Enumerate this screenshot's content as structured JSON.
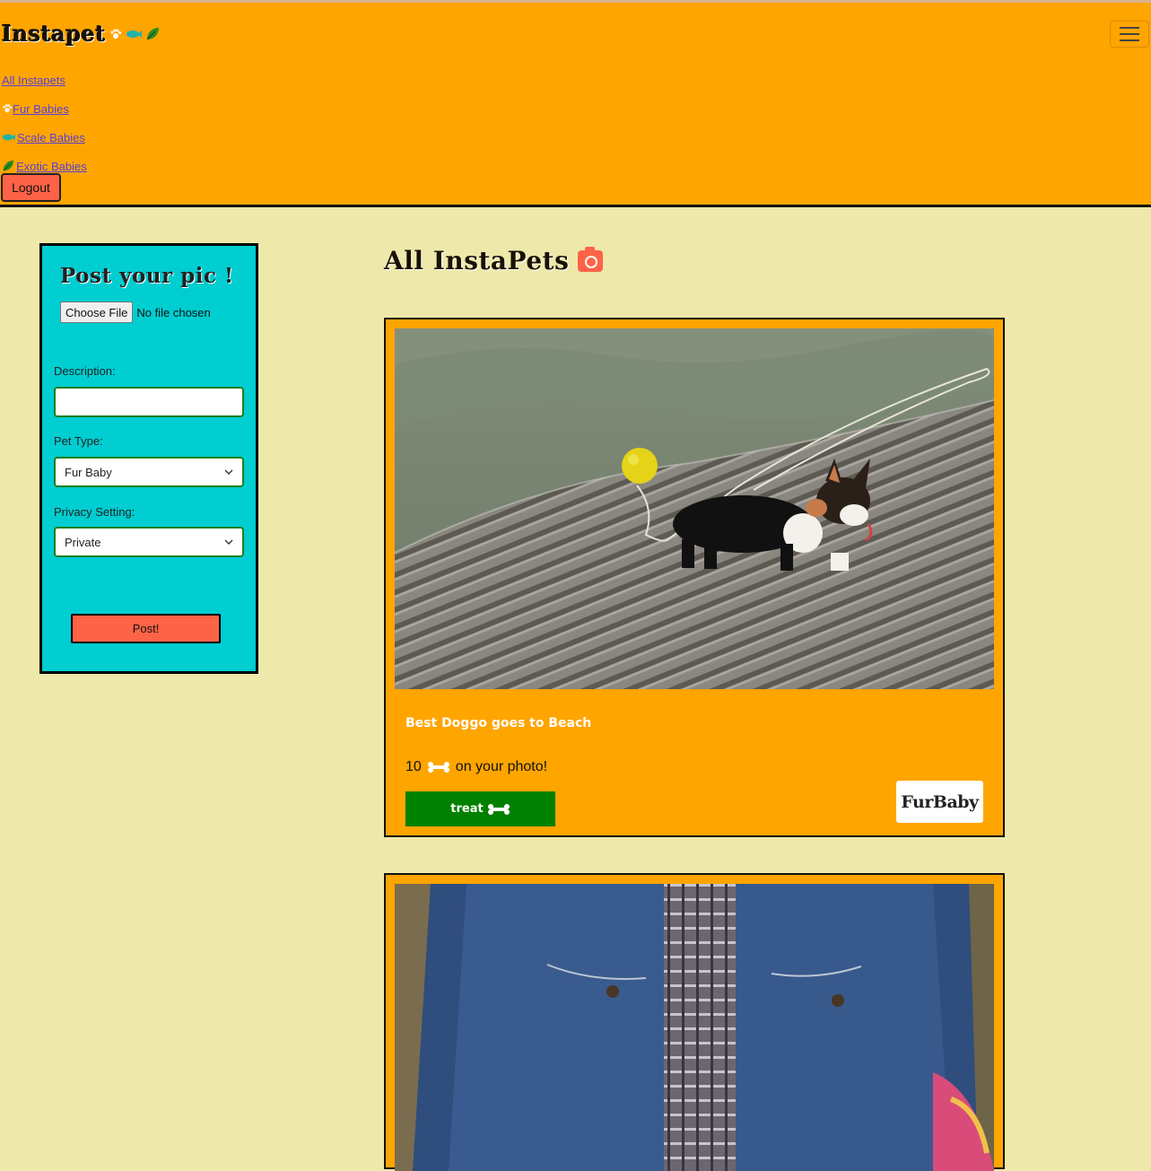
{
  "brand": {
    "name": "Instapet",
    "icons": [
      "paw-icon",
      "fish-icon",
      "leaf-icon"
    ]
  },
  "nav": {
    "items": [
      {
        "label": "All Instapets",
        "icon": ""
      },
      {
        "label": "Fur Babies",
        "icon": "paw-icon"
      },
      {
        "label": "Scale Babies",
        "icon": "fish-icon"
      },
      {
        "label": "Exotic Babies",
        "icon": "leaf-icon"
      }
    ],
    "logout_label": "Logout"
  },
  "post_form": {
    "title": "Post your pic !",
    "file_button_label": "Choose File",
    "file_status": "No file chosen",
    "description_label": "Description:",
    "description_value": "",
    "pet_type_label": "Pet Type:",
    "pet_type_value": "Fur Baby",
    "privacy_label": "Privacy Setting:",
    "privacy_value": "Private",
    "submit_label": "Post!"
  },
  "feed": {
    "title": "All InstaPets",
    "posts": [
      {
        "caption": "Best Doggo goes to Beach",
        "treat_count": "10",
        "treat_text": "on your photo!",
        "treat_button_label": "treat",
        "pet_type_badge": "FurBaby"
      },
      {
        "caption": "",
        "treat_count": "",
        "treat_text": "",
        "treat_button_label": "",
        "pet_type_badge": ""
      }
    ]
  },
  "colors": {
    "navbar": "#ffa500",
    "page_background": "#eee8aa",
    "form_background": "#00ced1",
    "logout_button": "#ff6347",
    "treat_button": "#008000",
    "fish": "#20b2aa",
    "leaf": "#2e8b20"
  }
}
